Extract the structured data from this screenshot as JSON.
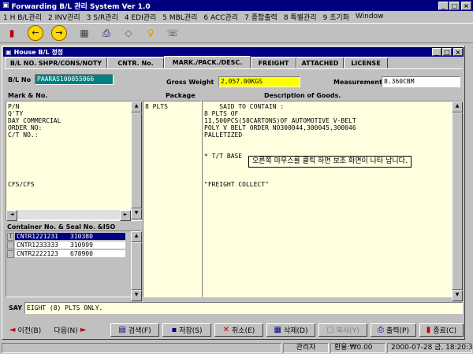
{
  "app": {
    "title": "Forwarding B/L 관리 System Ver 1.0",
    "menu": [
      "1 H B/L관리",
      "2 INV관리",
      "3 S/R관리",
      "4 EDI관리",
      "5 MBL관리",
      "6 ACC관리",
      "7 종합출력",
      "8 특별관리",
      "9 초기화",
      "Window"
    ]
  },
  "child": {
    "title": "House B/L 정정",
    "tabs": [
      "B/L NO. SHPR/CONS/NOTY",
      "CNTR. No.",
      "MARK./PACK./DESC.",
      "FREIGHT",
      "ATTACHED",
      "LICENSE"
    ],
    "active_tab": 2
  },
  "form": {
    "bl_no_label": "B/L No",
    "bl_no": "PAARAS100055066",
    "gross_weight_label": "Gross Weight",
    "gross_weight": "2,057.00KGS",
    "measurement_label": "Measurement",
    "measurement": "8.360CBM",
    "mark_label": "Mark & No.",
    "package_label": "Package",
    "desc_label": "Description of Goods.",
    "marks": "P/N\nQ'TY\nDAY COMMERCIAL\nORDER NO:\nC/T NO.:\n\n\n\n\n\n\nCFS/CFS",
    "package": "8 PLTS",
    "description": "    SAID TO CONTAIN :\n8 PLTS OF\n11,500PCS(58CARTONS)OF AUTOMOTIVE V-BELT\nPOLY V BELT ORDER NO300044,300045,300046\nPALLETIZED\n\n\n* T/T BASE\n\n\n\n\"FREIGHT COLLECT\"",
    "tooltip": "오른쪽 마우스를 클릭 하면 보조 화면이 나타 납니다.",
    "container_label": "Container No. & Seal No. &ISO",
    "containers": [
      {
        "cntr": "CNTR1221231",
        "seal": "310380"
      },
      {
        "cntr": "CNTR1233333",
        "seal": "310999"
      },
      {
        "cntr": "CNTR2222123",
        "seal": "678900"
      }
    ],
    "say_label": "SAY",
    "say": "EIGHT  (8) PLTS ONLY."
  },
  "buttons": {
    "prev": "이전(B)",
    "next": "다음(N)",
    "search": "검색(F)",
    "save": "저장(S)",
    "cancel": "취소(E)",
    "delete": "삭제(D)",
    "copy": "복사(Y)",
    "print": "출력(P)",
    "exit": "종료(C)"
  },
  "status": {
    "user": "관리자",
    "rate": "환율:₩0.00",
    "datetime": "2000-07-28 금, 18:20:37"
  },
  "colors": {
    "titlebar": "#000080",
    "bl_no_bg": "#008080",
    "gross_weight_bg": "#ffff00",
    "memo_bg": "#ffffe0"
  }
}
